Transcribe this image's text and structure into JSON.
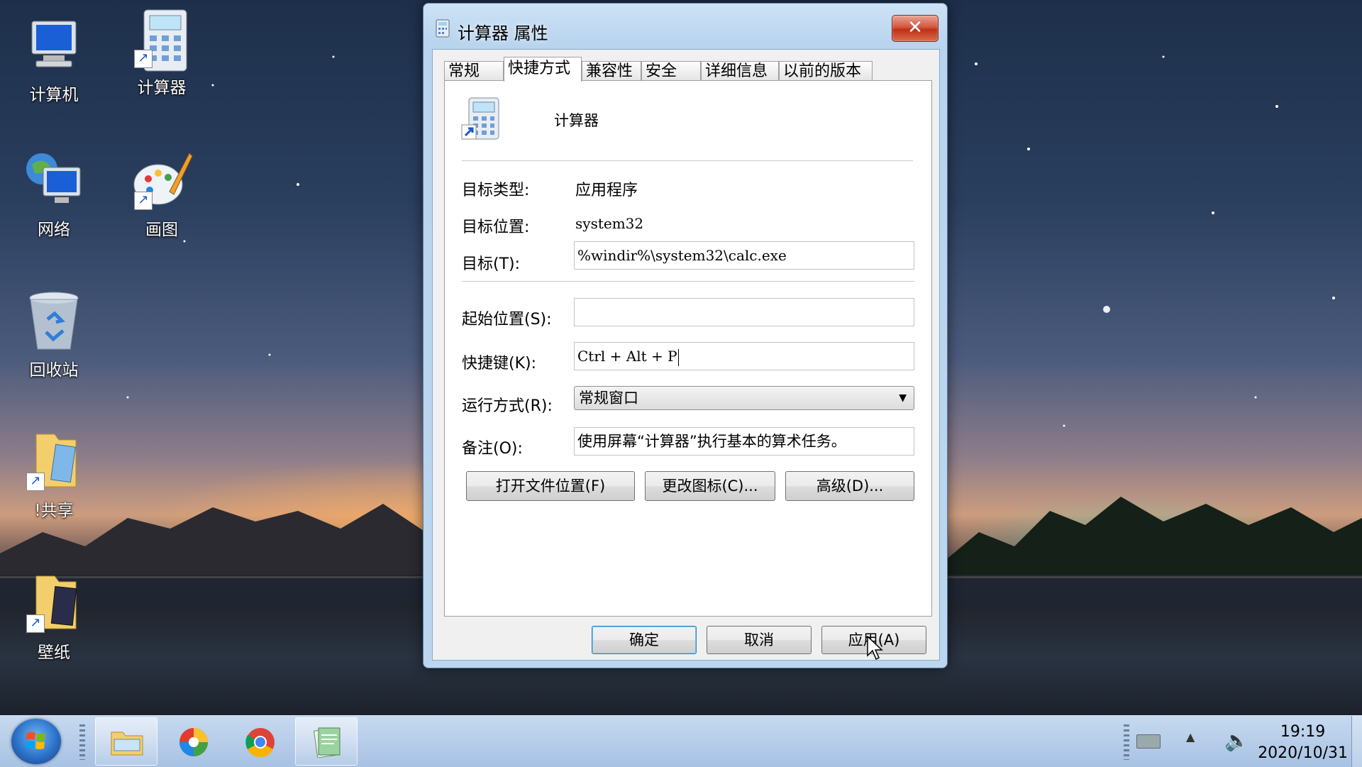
{
  "desktop": {
    "icons": [
      {
        "label": "计算机",
        "icon": "computer-icon"
      },
      {
        "label": "计算器",
        "icon": "calculator-icon"
      },
      {
        "label": "网络",
        "icon": "network-icon"
      },
      {
        "label": "画图",
        "icon": "paint-icon"
      },
      {
        "label": "回收站",
        "icon": "recycle-bin-icon"
      },
      {
        "label": "!共享",
        "icon": "shared-folder-icon"
      },
      {
        "label": "壁纸",
        "icon": "wallpaper-folder-icon"
      }
    ]
  },
  "dialog": {
    "title": "计算器 属性",
    "close_glyph": "✕",
    "tabs": [
      "常规",
      "快捷方式",
      "兼容性",
      "安全",
      "详细信息",
      "以前的版本"
    ],
    "active_tab": "快捷方式",
    "app_name": "计算器",
    "target_type_label": "目标类型:",
    "target_type_value": "应用程序",
    "target_location_label": "目标位置:",
    "target_location_value": "system32",
    "target_label": "目标(T):",
    "target_value": "%windir%\\system32\\calc.exe",
    "start_in_label": "起始位置(S):",
    "start_in_value": "",
    "shortcut_key_label": "快捷键(K):",
    "shortcut_key_value": "Ctrl + Alt + P",
    "run_label": "运行方式(R):",
    "run_value": "常规窗口",
    "comment_label": "备注(O):",
    "comment_value": "使用屏幕“计算器”执行基本的算术任务。",
    "open_location_button": "打开文件位置(F)",
    "change_icon_button": "更改图标(C)...",
    "advanced_button": "高级(D)...",
    "ok_button": "确定",
    "cancel_button": "取消",
    "apply_button": "应用(A)"
  },
  "taskbar": {
    "time": "19:19",
    "date": "2020/10/31",
    "pinned": [
      "file-explorer-icon",
      "pinwheel-app-icon",
      "chrome-icon",
      "notepad-app-icon"
    ]
  },
  "colors": {
    "close_red": "#c12f16",
    "title_blue": "#b9d4ee",
    "taskbar_blue": "#a8c2e3"
  }
}
